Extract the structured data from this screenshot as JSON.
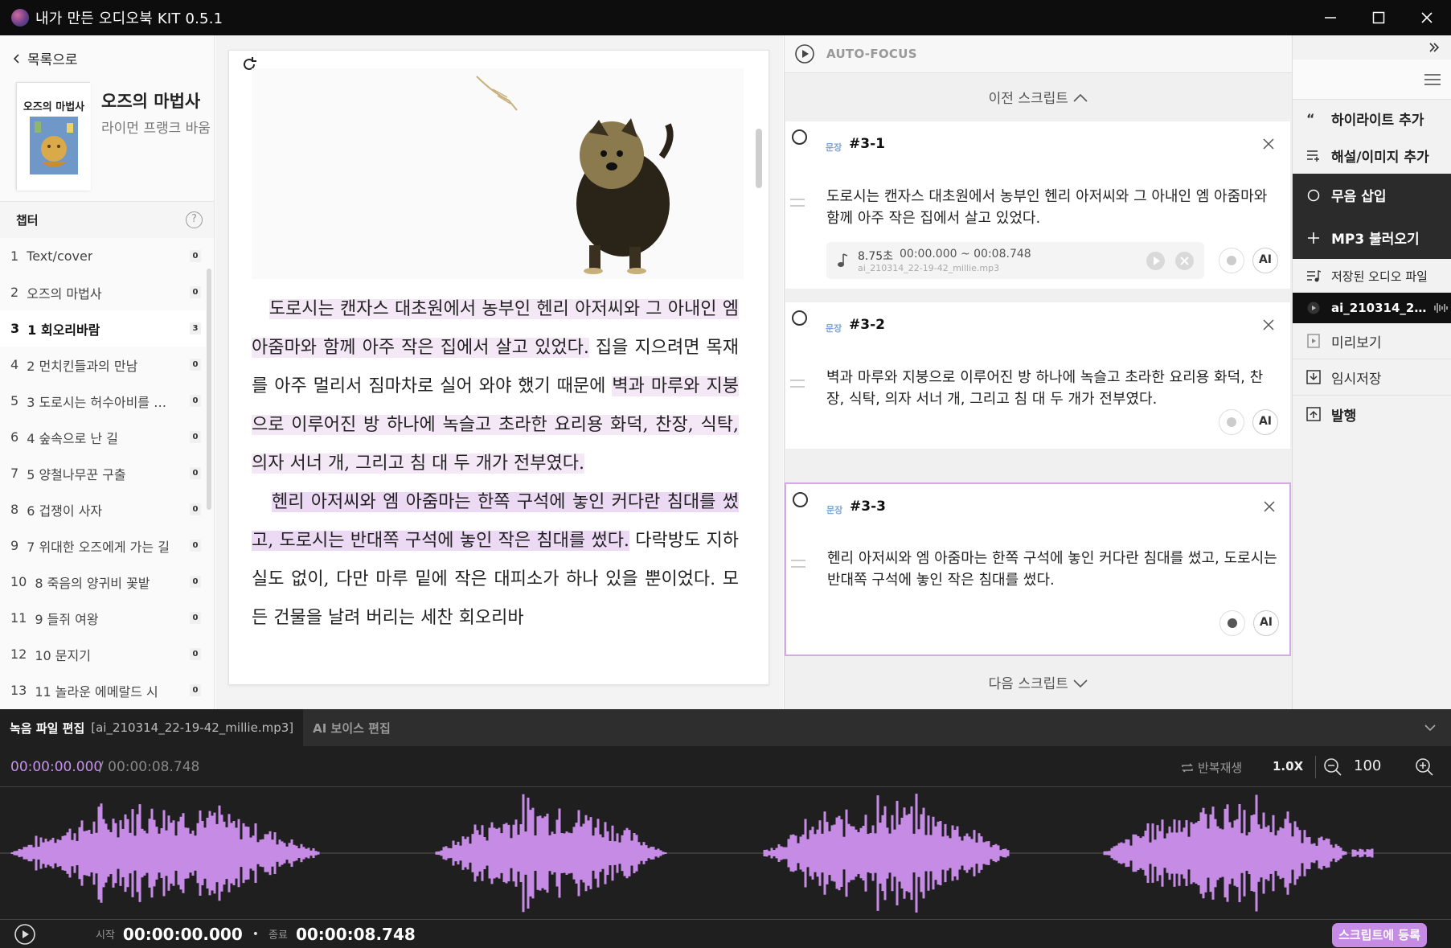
{
  "window": {
    "title": "내가 만든 오디오북 KIT 0.5.1"
  },
  "sidebar": {
    "back_label": "목록으로",
    "book": {
      "title": "오즈의 마법사",
      "author": "라이먼 프랭크 바움",
      "cover_title": "오즈의 마법사"
    },
    "chapters_label": "챕터",
    "help_label": "?",
    "chapters": [
      {
        "num": "1",
        "title": "Text/cover",
        "count": "0"
      },
      {
        "num": "2",
        "title": "오즈의 마법사",
        "count": "0"
      },
      {
        "num": "3",
        "title": "1 회오리바람",
        "count": "3"
      },
      {
        "num": "4",
        "title": "2 먼치킨들과의 만남",
        "count": "0"
      },
      {
        "num": "5",
        "title": "3 도로시는 허수아비를 어…",
        "count": "0"
      },
      {
        "num": "6",
        "title": "4 숲속으로 난 길",
        "count": "0"
      },
      {
        "num": "7",
        "title": "5 양철나무꾼 구출",
        "count": "0"
      },
      {
        "num": "8",
        "title": "6 겁쟁이 사자",
        "count": "0"
      },
      {
        "num": "9",
        "title": "7 위대한 오즈에게 가는 길",
        "count": "0"
      },
      {
        "num": "10",
        "title": "8 죽음의 양귀비 꽃밭",
        "count": "0"
      },
      {
        "num": "11",
        "title": "9 들쥐 여왕",
        "count": "0"
      },
      {
        "num": "12",
        "title": "10 문지기",
        "count": "0"
      },
      {
        "num": "13",
        "title": "11 놀라운 에메랄드 시",
        "count": "0"
      }
    ]
  },
  "reader": {
    "p1_hl1": "도로시는 캔자스 대초원에서 농부인 헨리 아저씨와 그 아내인 엠 아줌마와 함께 아주 작은 집에서 살고 있었다.",
    "p1_plain1": " 집을 지으려면 목재를 아주 멀리서 짐마차로 실어 와야 했기 때문에 ",
    "p1_hl2": "벽과 마루와 지붕으로 이루어진 방 하나에 녹슬고 초라한 요리용 화덕, 찬장, 식탁, 의자 서너 개, 그리고 침 대 두 개가 전부였다.",
    "p2_hl3": "헨리 아저씨와 엠 아줌마는 한쪽 구석에 놓인 커다란 침대를 썼고, 도로시는 반대쪽 구석에 놓인 작은 침대를 썼다.",
    "p2_plain": " 다락방도 지하실도 없이, 다만 마루 밑에 작은 대피소가 하나 있을 뿐이었다. 모든 건물을 날려 버리는 세찬 회오리바"
  },
  "scripts": {
    "autofocus_label": "AUTO-FOCUS",
    "prev_label": "이전 스크립트",
    "next_label": "다음 스크립트",
    "badge": "문장",
    "ai_label": "AI",
    "cards": [
      {
        "id": "#3-1",
        "text": "도로시는 캔자스 대초원에서 농부인 헨리 아저씨와 그 아내인 엠 아줌마와 함께 아주 작은 집에서 살고 있었다.",
        "audio": {
          "duration": "8.75초",
          "range": "00:00.000 ~ 00:08.748",
          "file": "ai_210314_22-19-42_millie.mp3"
        }
      },
      {
        "id": "#3-2",
        "text": "벽과 마루와 지붕으로 이루어진 방 하나에 녹슬고 초라한 요리용 화덕, 찬장, 식탁, 의자 서너 개, 그리고 침 대 두 개가 전부였다."
      },
      {
        "id": "#3-3",
        "text": "헨리 아저씨와 엠 아줌마는 한쪽 구석에 놓인 커다란 침대를 썼고, 도로시는 반대쪽 구석에 놓인 작은 침대를 썼다."
      }
    ]
  },
  "right_panel": {
    "add_highlight": "하이라이트 추가",
    "add_commentary": "해설/이미지 추가",
    "insert_silence": "무음 삽입",
    "load_mp3": "MP3 불러오기",
    "saved_audio": "저장된 오디오 파일",
    "audio_file": "ai_210314_2…",
    "preview": "미리보기",
    "temp_save": "임시저장",
    "publish": "발행"
  },
  "editor": {
    "tab_label": "녹음 파일 편집",
    "tab_file": "[ai_210314_22-19-42_millie.mp3]",
    "tab_ai": "AI 보이스 편집",
    "current_time": "00:00:00.000",
    "total_time": "/ 00:00:08.748",
    "repeat_label": "반복재생",
    "speed": "1.0X",
    "zoom": "100",
    "start_label": "시작",
    "start_time": "00:00:00.000",
    "end_label": "종료",
    "end_time": "00:00:08.748",
    "register_label": "스크립트에 등록",
    "wave_color": "#c58be5"
  }
}
